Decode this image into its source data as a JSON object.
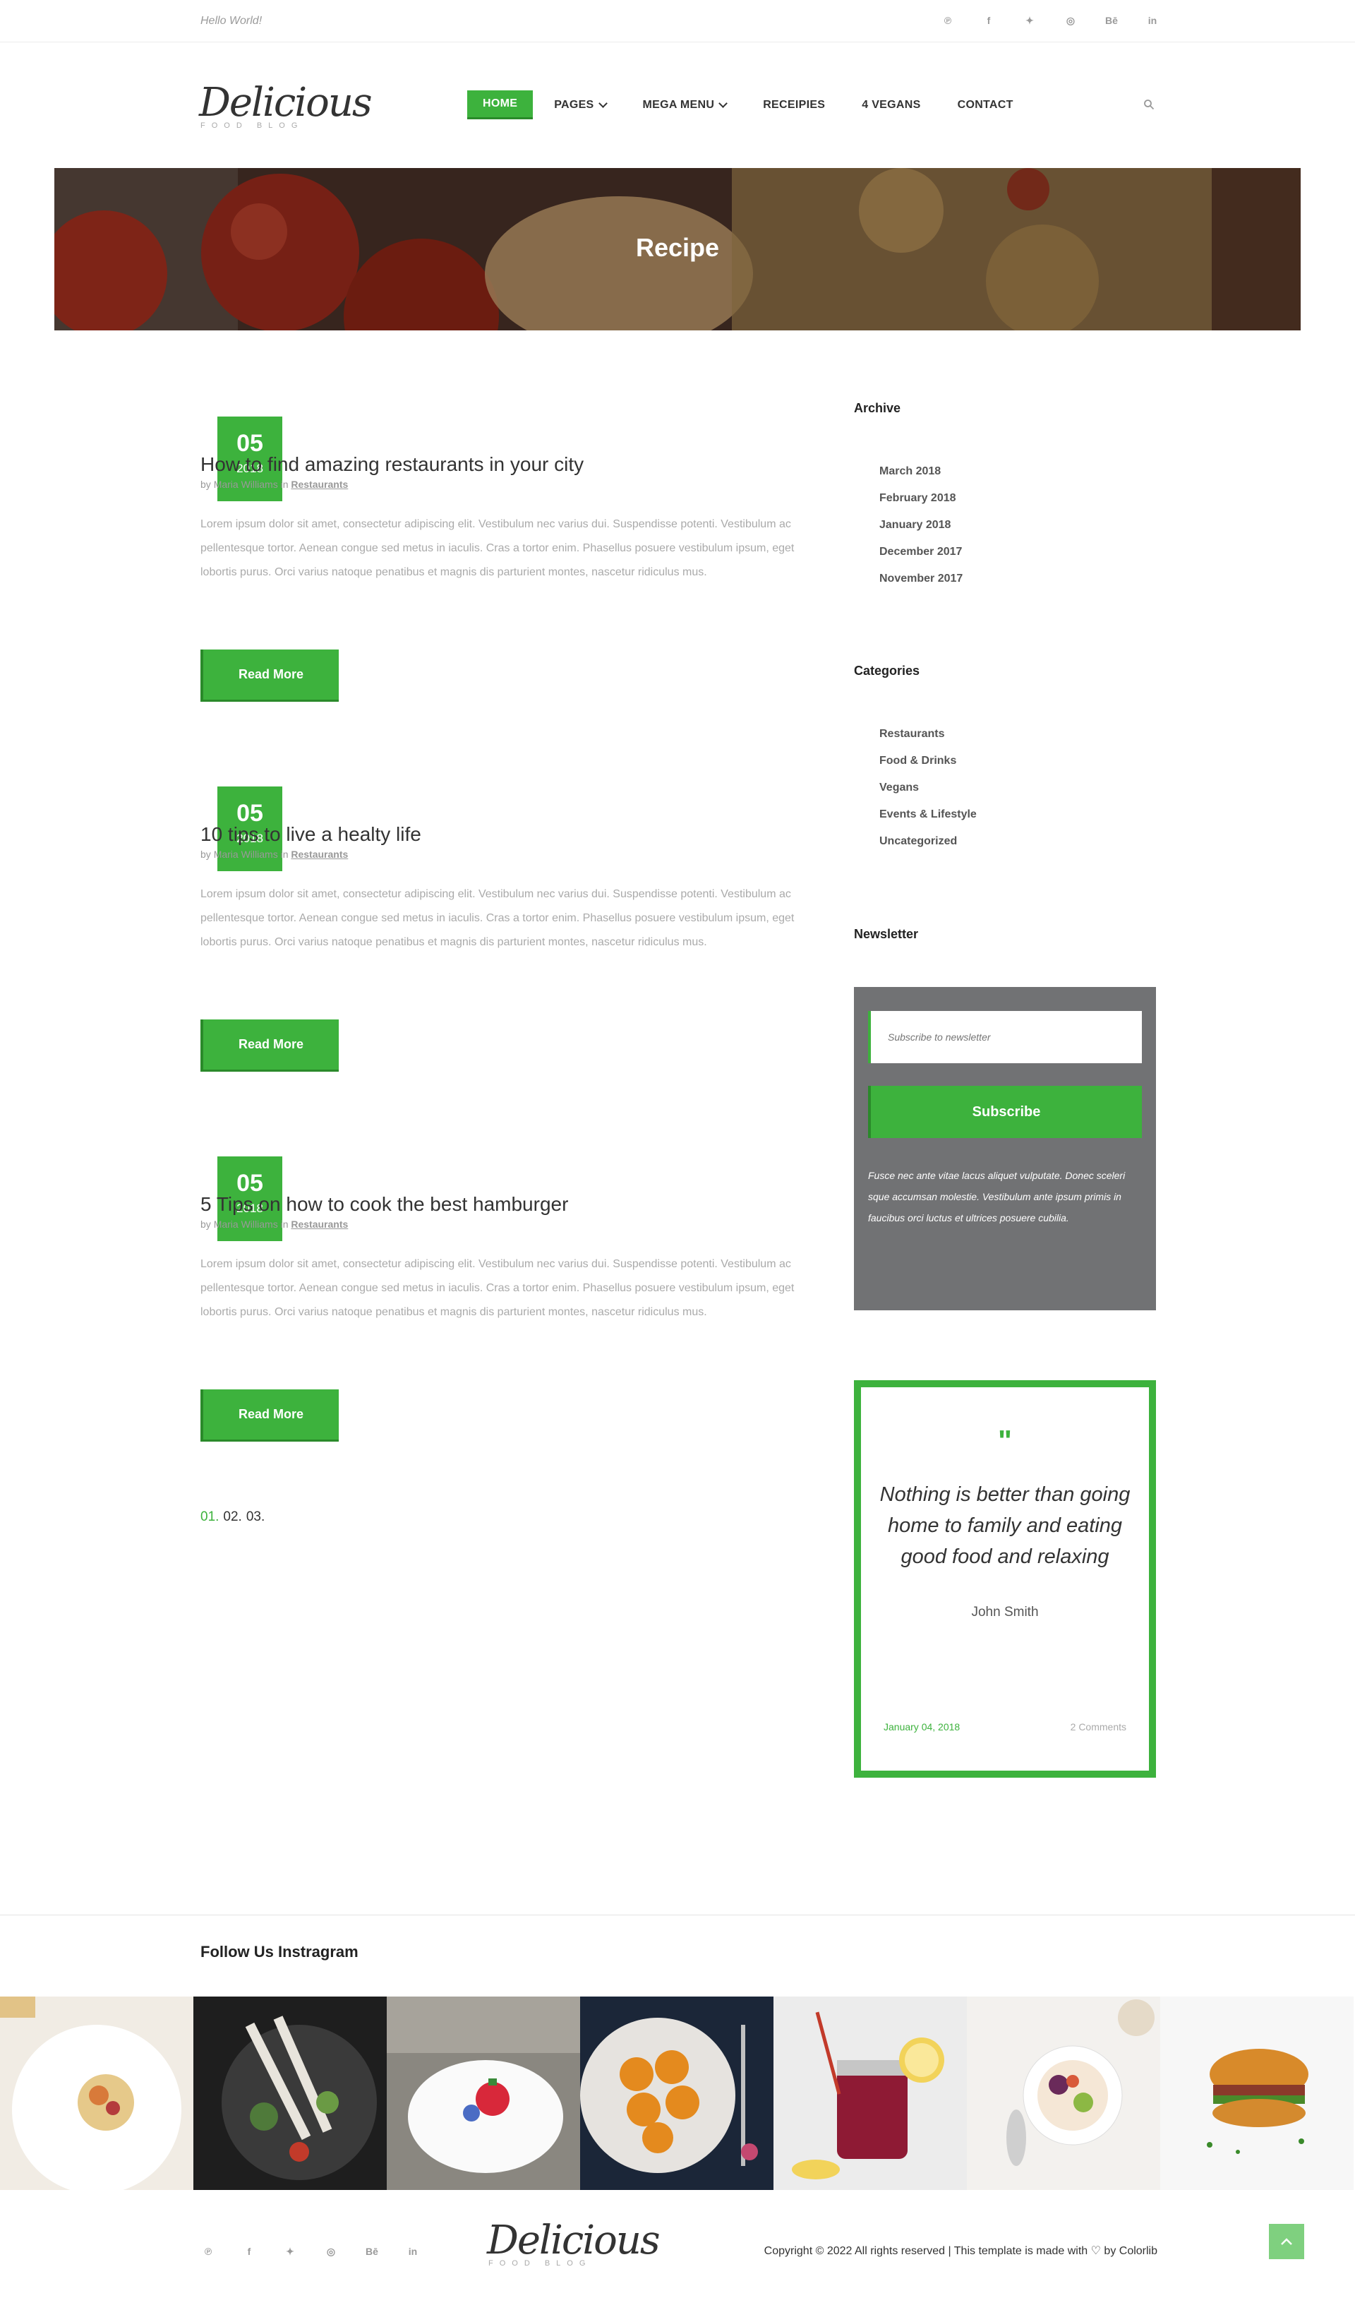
{
  "topbar": {
    "greeting": "Hello World!",
    "socials": [
      "pinterest-icon",
      "facebook-icon",
      "twitter-icon",
      "dribbble-icon",
      "behance-icon",
      "linkedin-icon"
    ],
    "social_glyphs": [
      "℗",
      "f",
      "✦",
      "◎",
      "Bē",
      "in"
    ]
  },
  "brand": {
    "name": "Delicious",
    "tagline": "FOOD BLOG"
  },
  "nav": {
    "items": [
      {
        "label": "Home",
        "active": true
      },
      {
        "label": "Pages",
        "dropdown": true
      },
      {
        "label": "Mega Menu",
        "dropdown": true
      },
      {
        "label": "Receipies"
      },
      {
        "label": "4 Vegans"
      },
      {
        "label": "Contact"
      }
    ]
  },
  "hero": {
    "title": "Recipe"
  },
  "posts": [
    {
      "day": "05",
      "year": "2018",
      "title": "How to find amazing restaurants in your city",
      "by": "by",
      "author": "Maria Williams",
      "in": "in",
      "category": "Restaurants",
      "excerpt": "Lorem ipsum dolor sit amet, consectetur adipiscing elit. Vestibulum nec varius dui. Suspendisse potenti. Vestibulum ac pellentesque tortor. Aenean congue sed metus in iaculis. Cras a tortor enim. Phasellus posuere vestibulum ipsum, eget lobortis purus. Orci varius natoque penatibus et magnis dis parturient montes, nascetur ridiculus mus.",
      "cta": "Read More"
    },
    {
      "day": "05",
      "year": "2018",
      "title": "10 tips to live a healty life",
      "by": "by",
      "author": "Maria Williams",
      "in": "in",
      "category": "Restaurants",
      "excerpt": "Lorem ipsum dolor sit amet, consectetur adipiscing elit. Vestibulum nec varius dui. Suspendisse potenti. Vestibulum ac pellentesque tortor. Aenean congue sed metus in iaculis. Cras a tortor enim. Phasellus posuere vestibulum ipsum, eget lobortis purus. Orci varius natoque penatibus et magnis dis parturient montes, nascetur ridiculus mus.",
      "cta": "Read More"
    },
    {
      "day": "05",
      "year": "2018",
      "title": "5 Tips on how to cook the best hamburger",
      "by": "by",
      "author": "Maria Williams",
      "in": "in",
      "category": "Restaurants",
      "excerpt": "Lorem ipsum dolor sit amet, consectetur adipiscing elit. Vestibulum nec varius dui. Suspendisse potenti. Vestibulum ac pellentesque tortor. Aenean congue sed metus in iaculis. Cras a tortor enim. Phasellus posuere vestibulum ipsum, eget lobortis purus. Orci varius natoque penatibus et magnis dis parturient montes, nascetur ridiculus mus.",
      "cta": "Read More"
    }
  ],
  "pagination": {
    "current": "01.",
    "pages": [
      "02.",
      "03."
    ]
  },
  "sidebar": {
    "archive": {
      "title": "Archive",
      "items": [
        "March 2018",
        "February 2018",
        "January 2018",
        "December 2017",
        "November 2017"
      ]
    },
    "categories": {
      "title": "Categories",
      "items": [
        "Restaurants",
        "Food & Drinks",
        "Vegans",
        "Events & Lifestyle",
        "Uncategorized"
      ]
    },
    "newsletter": {
      "title": "Newsletter",
      "placeholder": "Subscribe to newsletter",
      "button": "Subscribe",
      "text": "Fusce nec ante vitae lacus aliquet vulputate. Donec sceleri sque accumsan molestie. Vestibulum ante ipsum primis in faucibus orci luctus et ultrices posuere cubilia."
    },
    "quote": {
      "mark": "\"",
      "text": "Nothing is better than going home to family and eating good food and relaxing",
      "author": "John Smith",
      "date": "January 04, 2018",
      "comments": "2 Comments"
    }
  },
  "instagram": {
    "title": "Follow Us Instragram"
  },
  "footer": {
    "copyright": "Copyright © 2022 All rights reserved | This template is made with ♡ by Colorlib"
  },
  "colors": {
    "accent": "#3db23d",
    "newsletter_bg": "#717274"
  }
}
